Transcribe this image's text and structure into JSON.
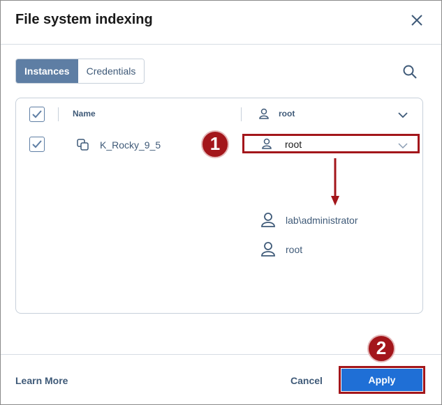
{
  "dialog": {
    "title": "File system indexing",
    "close_icon": "close-icon"
  },
  "tabs": [
    {
      "label": "Instances",
      "active": true
    },
    {
      "label": "Credentials",
      "active": false
    }
  ],
  "search_icon": "search-icon",
  "table": {
    "header": {
      "name_label": "Name",
      "user_label": "root"
    },
    "rows": [
      {
        "name": "K_Rocky_9_5",
        "checked": true,
        "user": "root"
      }
    ]
  },
  "dropdown_options": [
    {
      "label": "lab\\administrator"
    },
    {
      "label": "root"
    }
  ],
  "annotations": {
    "step1": "1",
    "step2": "2",
    "accent_color": "#a3161b"
  },
  "footer": {
    "learn_more": "Learn More",
    "cancel": "Cancel",
    "apply": "Apply"
  },
  "colors": {
    "primary": "#1f6fd6",
    "tab_active": "#5e7ea4",
    "text_link": "#3f5a78"
  }
}
